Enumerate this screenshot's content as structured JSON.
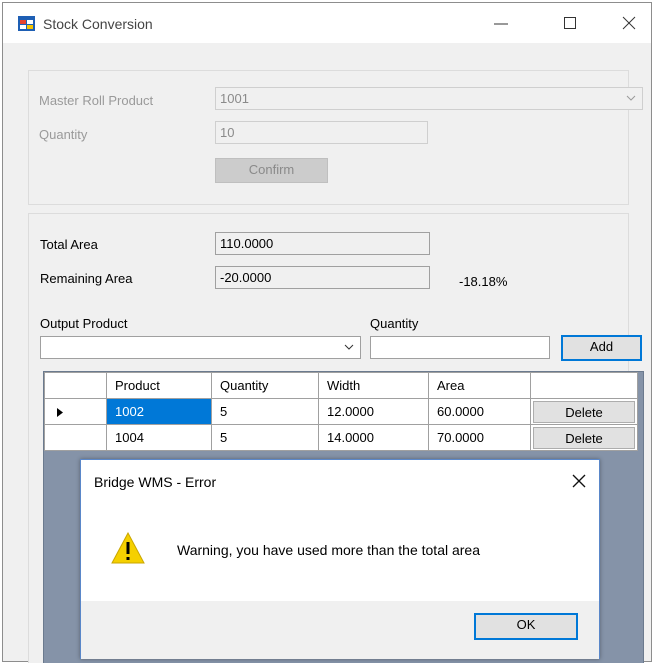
{
  "window": {
    "title": "Stock Conversion"
  },
  "colors": {
    "accent": "#0078d7",
    "grid_background": "#8593a8",
    "warning": "#f5d000"
  },
  "master_section": {
    "master_roll_product_label": "Master Roll Product",
    "master_roll_product_value": "1001",
    "quantity_label": "Quantity",
    "quantity_value": "10",
    "confirm_label": "Confirm"
  },
  "area_section": {
    "total_area_label": "Total Area",
    "total_area_value": "110.0000",
    "remaining_area_label": "Remaining Area",
    "remaining_area_value": "-20.0000",
    "remaining_percent": "-18.18%"
  },
  "output_section": {
    "output_product_label": "Output Product",
    "output_product_value": "",
    "quantity_label": "Quantity",
    "quantity_value": "",
    "add_label": "Add"
  },
  "grid": {
    "columns": [
      "Product",
      "Quantity",
      "Width",
      "Area"
    ],
    "rows": [
      {
        "product": "1002",
        "quantity": "5",
        "width": "12.0000",
        "area": "60.0000",
        "action": "Delete"
      },
      {
        "product": "1004",
        "quantity": "5",
        "width": "14.0000",
        "area": "70.0000",
        "action": "Delete"
      }
    ]
  },
  "dialog": {
    "title": "Bridge WMS - Error",
    "message": "Warning, you have used more than the total area",
    "ok_label": "OK",
    "icon": "warning-icon"
  }
}
